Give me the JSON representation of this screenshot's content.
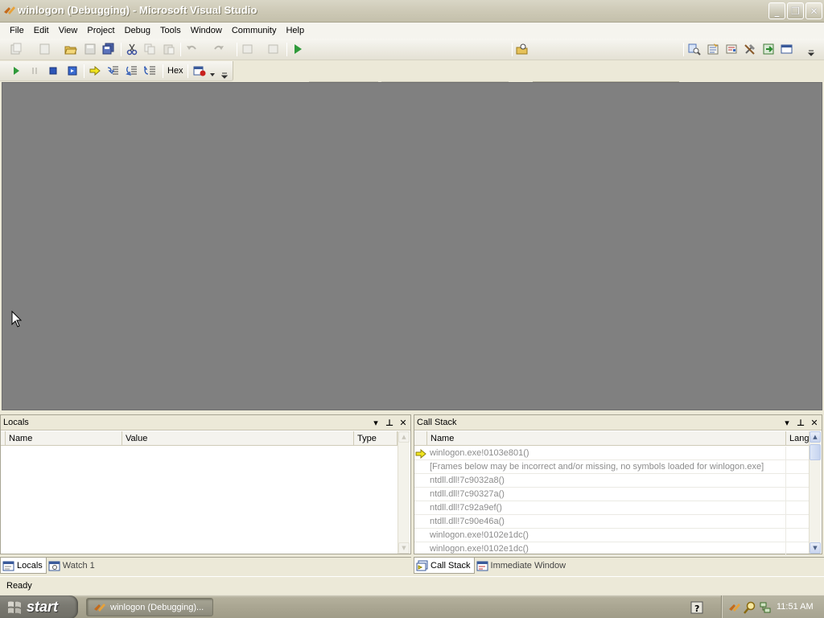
{
  "window": {
    "title": "winlogon (Debugging) - Microsoft Visual Studio"
  },
  "menu": [
    "File",
    "Edit",
    "View",
    "Project",
    "Debug",
    "Tools",
    "Window",
    "Community",
    "Help"
  ],
  "debug_toolbar": {
    "hex_label": "Hex"
  },
  "locals_panel": {
    "title": "Locals",
    "columns": [
      "Name",
      "Value",
      "Type"
    ]
  },
  "callstack_panel": {
    "title": "Call Stack",
    "columns": [
      "Name",
      "Langu"
    ],
    "rows": [
      "winlogon.exe!0103e801()",
      "[Frames below may be incorrect and/or missing, no symbols loaded for winlogon.exe]",
      "ntdll.dll!7c9032a8()",
      "ntdll.dll!7c90327a()",
      "ntdll.dll!7c92a9ef()",
      "ntdll.dll!7c90e46a()",
      "winlogon.exe!0102e1dc()",
      "winlogon.exe!0102e1dc()"
    ],
    "current_row_index": 0
  },
  "left_tabs": [
    "Locals",
    "Watch 1"
  ],
  "right_tabs": [
    "Call Stack",
    "Immediate Window"
  ],
  "status": {
    "text": "Ready"
  },
  "taskbar": {
    "start_label": "start",
    "task_label": "winlogon (Debugging)...",
    "clock": "11:51 AM"
  },
  "colors": {
    "workspace": "#808080",
    "chrome": "#ece9d8",
    "current_frame_arrow": "#f2e61e",
    "disabled_text": "#8c8c8c"
  }
}
